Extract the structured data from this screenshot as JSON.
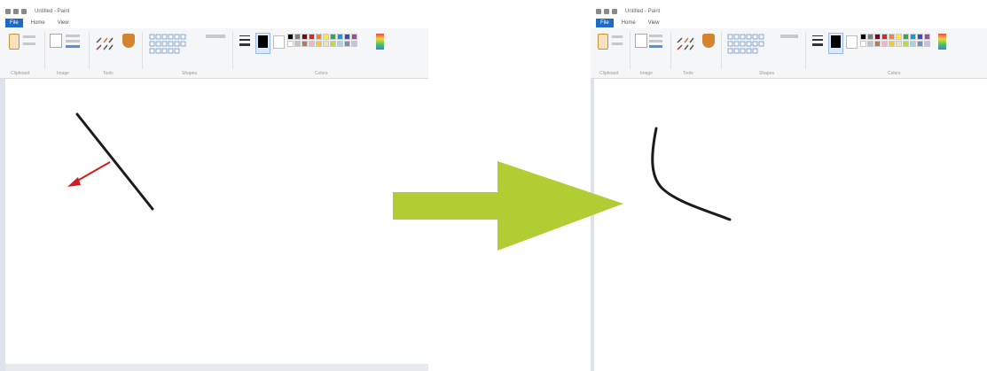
{
  "colors": {
    "arrow": "#b2cc34",
    "selection_arrow": "#d11c1c",
    "stroke": "#1b1b1b",
    "file_tab": "#1e6bc7"
  },
  "left_window": {
    "title": "Untitled - Paint",
    "tabs": [
      "File",
      "Home",
      "View"
    ],
    "groups": [
      "Clipboard",
      "Image",
      "Tools",
      "Shapes",
      "Colors"
    ]
  },
  "right_window": {
    "title": "Untitled - Paint",
    "tabs": [
      "File",
      "Home",
      "View"
    ],
    "groups": [
      "Clipboard",
      "Image",
      "Tools",
      "Shapes",
      "Colors"
    ]
  },
  "palette_colors": [
    "#000000",
    "#7f7f7f",
    "#880015",
    "#ed1c24",
    "#ff7f27",
    "#fff200",
    "#22b14c",
    "#00a2e8",
    "#3f48cc",
    "#a349a4",
    "#ffffff",
    "#c3c3c3",
    "#b97a57",
    "#ffaec9",
    "#ffc90e",
    "#efe4b0",
    "#b5e61d",
    "#99d9ea",
    "#7092be",
    "#c8bfe7"
  ],
  "icons": {
    "transition": "right-arrow-icon",
    "drag_hint": "drag-direction-arrow-icon",
    "line_before": "straight-line-icon",
    "line_after": "curved-line-icon"
  }
}
